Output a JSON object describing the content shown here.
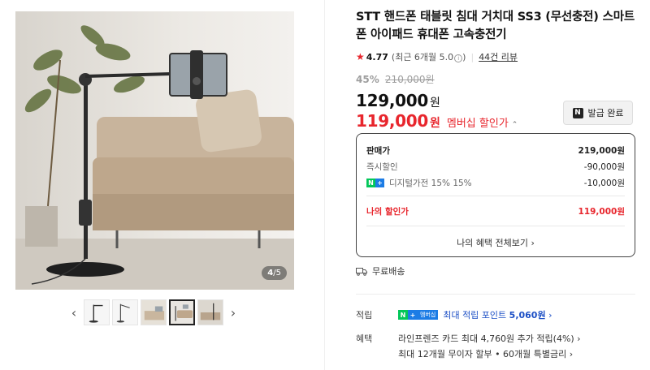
{
  "product": {
    "title": "STT 핸드폰 태블릿 침대 거치대 SS3 (무선충전) 스마트폰 아이패드 휴대폰 고속충전기"
  },
  "gallery": {
    "counter_current": "4",
    "counter_total": "/5",
    "prev_arrow": "‹",
    "next_arrow": "›",
    "thumb_count": 5,
    "active_thumb": 4
  },
  "rating": {
    "star": "★",
    "score": "4.77",
    "recent_prefix": "(최근 6개월 5.0",
    "recent_suffix": ")",
    "info_icon": "i",
    "separator": "|",
    "review_link": "44건 리뷰"
  },
  "pricing": {
    "discount_rate": "45%",
    "original_price": "210,000원",
    "price": "129,000",
    "price_unit": "원",
    "member_price": "119,000",
    "member_unit": "원",
    "member_label": "멤버십 할인가",
    "member_toggle": "⌃",
    "coupon_badge": "N",
    "coupon_label": "발급 완료"
  },
  "breakdown": {
    "rows": [
      {
        "key": "판매가",
        "value": "219,000원"
      },
      {
        "key": "즉시할인",
        "value": "-90,000원"
      },
      {
        "key": "디지털가전 15% 15%",
        "value": "-10,000원"
      }
    ],
    "mine_key": "나의 할인가",
    "mine_value": "119,000원",
    "footer": "나의 혜택 전체보기 ›",
    "badge_g": "N",
    "badge_b": "+"
  },
  "shipping": {
    "icon": "truck-icon",
    "label": "무료배송"
  },
  "earn": {
    "label": "적립",
    "badge_g": "N",
    "badge_b": "+",
    "badge_text": "멤버십",
    "text_prefix": "최대 적립 포인트",
    "points": "5,060원",
    "chevron": "›"
  },
  "benefit": {
    "label": "혜택",
    "line1": "라인프렌즈 카드 최대 4,760원 추가 적립(4%) ›",
    "line2": "최대 12개월 무이자 할부 • 60개월 특별금리 ›"
  },
  "colors": {
    "accent_red": "#e8262d",
    "naver_green": "#03c75a",
    "naver_blue": "#1c7ce5"
  }
}
